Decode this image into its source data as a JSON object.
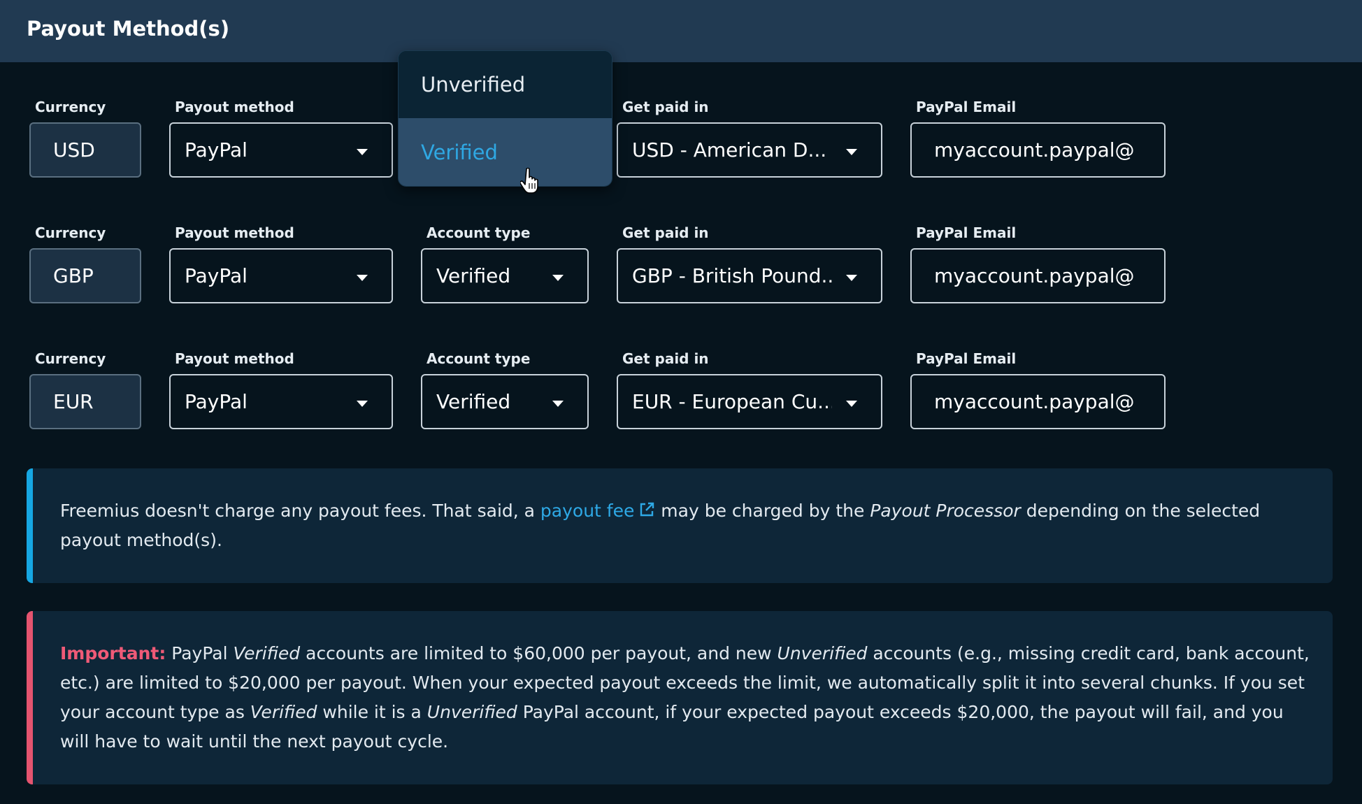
{
  "header": {
    "title": "Payout Method(s)"
  },
  "labels": {
    "currency": "Currency",
    "payout_method": "Payout method",
    "account_type": "Account type",
    "get_paid_in": "Get paid in",
    "paypal_email": "PayPal Email"
  },
  "rows": [
    {
      "currency": "USD",
      "payout_method": "PayPal",
      "account_type": "Verified",
      "get_paid_in": "USD - American D...",
      "email": "myaccount.paypal@"
    },
    {
      "currency": "GBP",
      "payout_method": "PayPal",
      "account_type": "Verified",
      "get_paid_in": "GBP - British Pound...",
      "email": "myaccount.paypal@"
    },
    {
      "currency": "EUR",
      "payout_method": "PayPal",
      "account_type": "Verified",
      "get_paid_in": "EUR - European Cu...",
      "email": "myaccount.paypal@"
    }
  ],
  "dropdown": {
    "options": [
      "Unverified",
      "Verified"
    ],
    "highlighted": "Verified"
  },
  "info_notice": {
    "part1": "Freemius doesn't charge any payout fees. That said, a ",
    "link": "payout fee",
    "part2": " may be charged by the ",
    "em1": "Payout Processor",
    "part3": " depending on the selected payout method(s)."
  },
  "warn_notice": {
    "label": "Important:",
    "t1": " PayPal ",
    "em1": "Verified",
    "t2": " accounts are limited to $60,000 per payout, and new ",
    "em2": "Unverified",
    "t3": " accounts (e.g., missing credit card, bank account, etc.) are limited to $20,000 per payout. When your expected payout exceeds the limit, we automatically split it into several chunks. If you set your account type as ",
    "em3": "Verified",
    "t4": " while it is a ",
    "em4": "Unverified",
    "t5": " PayPal account, if your expected payout exceeds $20,000, the payout will fail, and you will have to wait until the next payout cycle."
  },
  "colors": {
    "background": "#06141d",
    "header": "#213a52",
    "link": "#2ea9e6",
    "info_accent": "#16a7e3",
    "warn_accent": "#e5546f"
  }
}
